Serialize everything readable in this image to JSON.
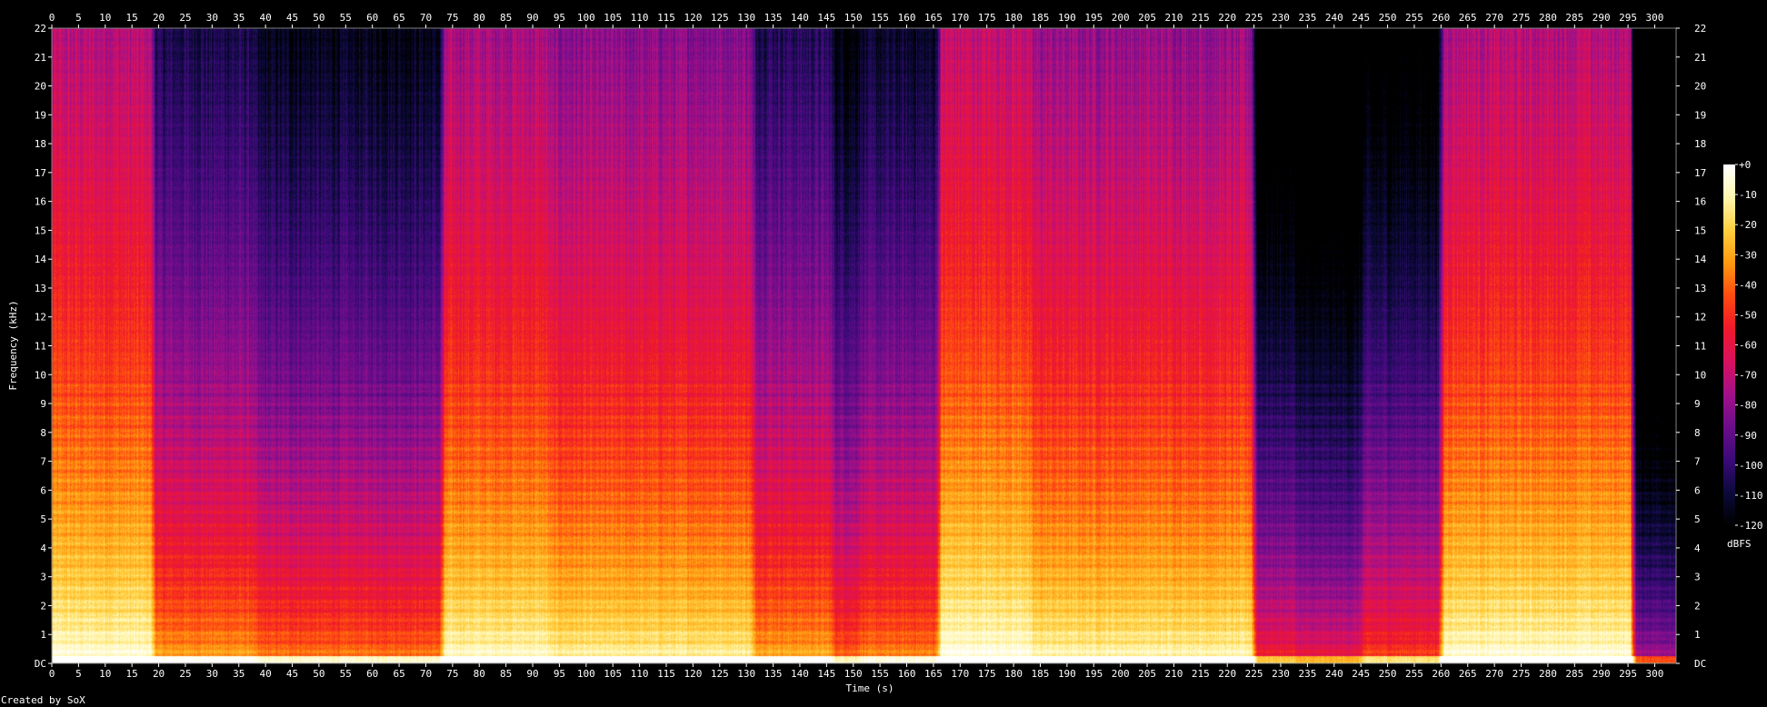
{
  "chart_data": {
    "type": "heatmap",
    "title": "",
    "xlabel": "Time (s)",
    "ylabel": "Frequency (kHz)",
    "xlim": [
      0,
      304
    ],
    "ylim": [
      0,
      22
    ],
    "x_ticks": [
      0,
      5,
      10,
      15,
      20,
      25,
      30,
      35,
      40,
      45,
      50,
      55,
      60,
      65,
      70,
      75,
      80,
      85,
      90,
      95,
      100,
      105,
      110,
      115,
      120,
      125,
      130,
      135,
      140,
      145,
      150,
      155,
      160,
      165,
      170,
      175,
      180,
      185,
      190,
      195,
      200,
      205,
      210,
      215,
      220,
      225,
      230,
      235,
      240,
      245,
      250,
      255,
      260,
      265,
      270,
      275,
      280,
      285,
      290,
      295,
      300
    ],
    "y_ticks": [
      "DC",
      "1",
      "2",
      "3",
      "4",
      "5",
      "6",
      "7",
      "8",
      "9",
      "10",
      "11",
      "12",
      "13",
      "14",
      "15",
      "16",
      "17",
      "18",
      "19",
      "20",
      "21",
      "22"
    ],
    "colorbar": {
      "label": "dBFS",
      "range": [
        -120,
        0
      ],
      "ticks": [
        "+0",
        "-10",
        "-20",
        "-30",
        "-40",
        "-50",
        "-60",
        "-70",
        "-80",
        "-90",
        "-100",
        "-110",
        "-120"
      ]
    },
    "palette": [
      "#000000",
      "#0b0a3a",
      "#3a0a78",
      "#6a0d8a",
      "#a0108a",
      "#d81060",
      "#f01a28",
      "#ff4e10",
      "#ff9a10",
      "#ffd040",
      "#fff7b0",
      "#ffffff"
    ],
    "segments": [
      {
        "start": 0,
        "end": 19,
        "level": 0.72
      },
      {
        "start": 19,
        "end": 38,
        "level": 0.5
      },
      {
        "start": 38,
        "end": 73,
        "level": 0.44
      },
      {
        "start": 73,
        "end": 93,
        "level": 0.7
      },
      {
        "start": 93,
        "end": 131,
        "level": 0.66
      },
      {
        "start": 131,
        "end": 146,
        "level": 0.52
      },
      {
        "start": 146,
        "end": 151,
        "level": 0.42
      },
      {
        "start": 151,
        "end": 166,
        "level": 0.46
      },
      {
        "start": 166,
        "end": 183,
        "level": 0.74
      },
      {
        "start": 183,
        "end": 225,
        "level": 0.68
      },
      {
        "start": 225,
        "end": 233,
        "level": 0.3
      },
      {
        "start": 233,
        "end": 245,
        "level": 0.26
      },
      {
        "start": 245,
        "end": 260,
        "level": 0.36
      },
      {
        "start": 260,
        "end": 296,
        "level": 0.72
      },
      {
        "start": 296,
        "end": 304,
        "level": 0.12
      }
    ]
  },
  "footer": {
    "credit": "Created by SoX"
  }
}
